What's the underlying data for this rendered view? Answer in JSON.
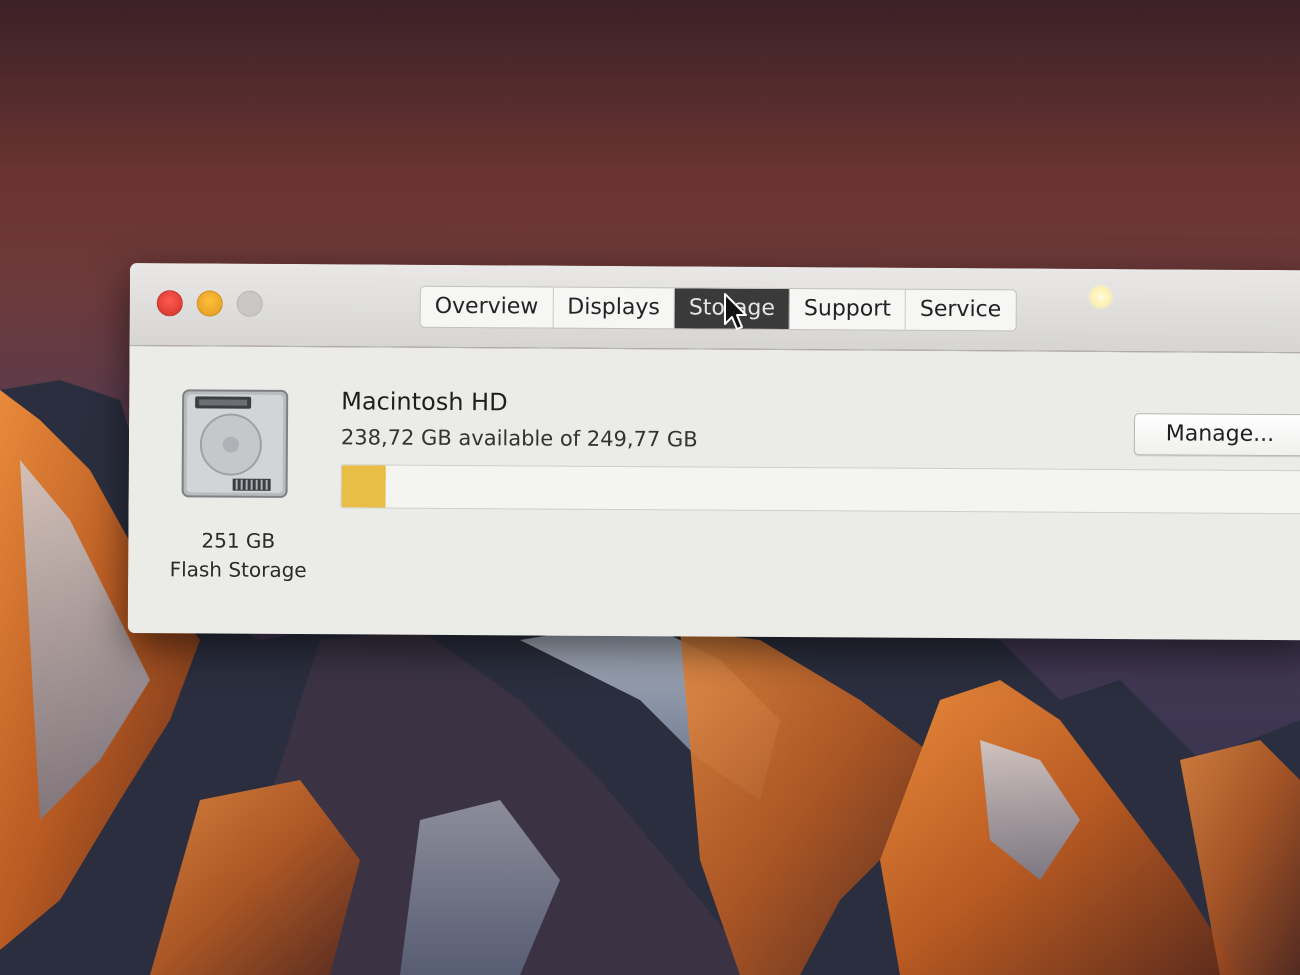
{
  "window": {
    "tabs": [
      {
        "label": "Overview"
      },
      {
        "label": "Displays"
      },
      {
        "label": "Storage"
      },
      {
        "label": "Support"
      },
      {
        "label": "Service"
      }
    ],
    "active_tab": "Storage"
  },
  "storage": {
    "drive_capacity": "251 GB",
    "drive_type": "Flash Storage",
    "volume_name": "Macintosh HD",
    "availability": "238,72 GB available of 249,77 GB",
    "used_fraction": 0.044,
    "used_color": "#e8be47",
    "manage_label": "Manage..."
  },
  "icons": {
    "drive": "hard-drive-icon",
    "cursor": "arrow-cursor-icon"
  }
}
